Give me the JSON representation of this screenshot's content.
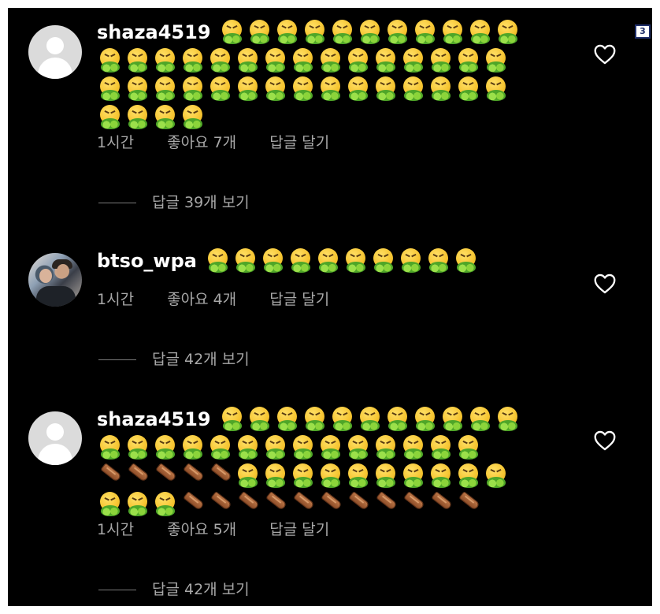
{
  "page_indicator": "3",
  "comments": [
    {
      "username": "shaza4519",
      "avatar": "default-avatar",
      "emoji_rows": [
        [
          "nauseated",
          "nauseated",
          "nauseated",
          "nauseated",
          "nauseated",
          "nauseated",
          "nauseated",
          "nauseated",
          "nauseated",
          "nauseated",
          "nauseated"
        ],
        [
          "nauseated",
          "nauseated",
          "nauseated",
          "nauseated",
          "nauseated",
          "nauseated",
          "nauseated",
          "nauseated",
          "nauseated",
          "nauseated",
          "nauseated",
          "nauseated",
          "nauseated",
          "nauseated",
          "nauseated"
        ],
        [
          "nauseated",
          "nauseated",
          "nauseated",
          "nauseated",
          "nauseated",
          "nauseated",
          "nauseated",
          "nauseated",
          "nauseated",
          "nauseated",
          "nauseated",
          "nauseated",
          "nauseated",
          "nauseated",
          "nauseated"
        ],
        [
          "nauseated",
          "nauseated",
          "nauseated",
          "nauseated"
        ]
      ],
      "time": "1시간",
      "likes": "좋아요 7개",
      "reply_label": "답글 달기",
      "view_replies": "답글 39개 보기"
    },
    {
      "username": "btso_wpa",
      "avatar": "photo-avatar",
      "emoji_rows": [
        [
          "nauseated",
          "nauseated",
          "nauseated",
          "nauseated",
          "nauseated",
          "nauseated",
          "nauseated",
          "nauseated",
          "nauseated",
          "nauseated"
        ]
      ],
      "time": "1시간",
      "likes": "좋아요 4개",
      "reply_label": "답글 달기",
      "view_replies": "답글 42개 보기"
    },
    {
      "username": "shaza4519",
      "avatar": "default-avatar",
      "emoji_rows": [
        [
          "nauseated",
          "nauseated",
          "nauseated",
          "nauseated",
          "nauseated",
          "nauseated",
          "nauseated",
          "nauseated",
          "nauseated",
          "nauseated",
          "nauseated"
        ],
        [
          "nauseated",
          "nauseated",
          "nauseated",
          "nauseated",
          "nauseated",
          "nauseated",
          "nauseated",
          "nauseated",
          "nauseated",
          "nauseated",
          "nauseated",
          "nauseated",
          "nauseated",
          "nauseated"
        ],
        [
          "coffin",
          "coffin",
          "coffin",
          "coffin",
          "coffin",
          "nauseated",
          "nauseated",
          "nauseated",
          "nauseated",
          "nauseated",
          "nauseated",
          "nauseated",
          "nauseated",
          "nauseated",
          "nauseated"
        ],
        [
          "nauseated",
          "nauseated",
          "nauseated",
          "coffin",
          "coffin",
          "coffin",
          "coffin",
          "coffin",
          "coffin",
          "coffin",
          "coffin",
          "coffin",
          "coffin",
          "coffin"
        ]
      ],
      "time": "1시간",
      "likes": "좋아요 5개",
      "reply_label": "답글 달기",
      "view_replies": "답글 42개 보기"
    }
  ],
  "colors": {
    "background": "#000000",
    "primary_text": "#ffffff",
    "secondary_text": "#a8a8a8"
  },
  "icons": {
    "like": "heart-outline-icon",
    "nauseated": "nauseated-face-emoji",
    "coffin": "coffin-emoji"
  }
}
